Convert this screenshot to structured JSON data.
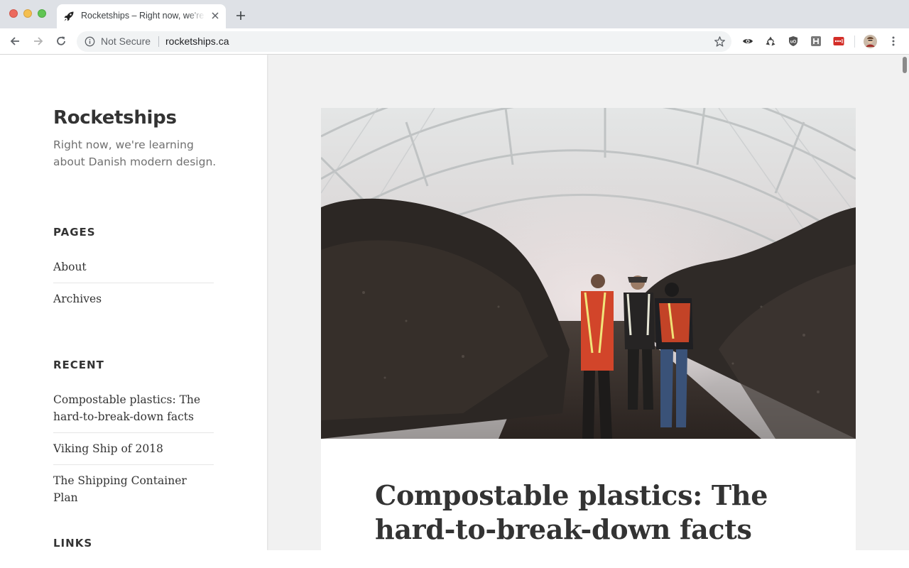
{
  "browser": {
    "tab": {
      "title": "Rocketships – Right now, we're learning about Danish modern design."
    },
    "omnibox": {
      "security_status": "Not Secure",
      "url": "rocketships.ca"
    },
    "icons": [
      "back-icon",
      "forward-icon",
      "reload-icon",
      "info-icon",
      "star-icon",
      "eye-extension-icon",
      "recycle-extension-icon",
      "shield-extension-icon",
      "h-extension-icon",
      "lastpass-extension-icon",
      "profile-avatar",
      "menu-icon"
    ]
  },
  "site": {
    "title": "Rocketships",
    "description": "Right now, we're learning about Danish modern design."
  },
  "sidebar": {
    "pages": {
      "heading": "PAGES",
      "items": [
        "About",
        "Archives"
      ]
    },
    "recent": {
      "heading": "RECENT",
      "items": [
        "Compostable plastics: The hard-to-break-down facts",
        "Viking Ship of 2018",
        "The Shipping Container Plan"
      ]
    },
    "links": {
      "heading": "LINKS"
    }
  },
  "article": {
    "title": "Compostable plastics: The hard-to-break-down facts",
    "image": "photo of workers in safety vests standing between large compost piles under a dome tent"
  },
  "colors": {
    "page_bg": "#f1f1f1",
    "text": "#333333",
    "muted": "#707070",
    "chrome": "#dee1e6"
  }
}
